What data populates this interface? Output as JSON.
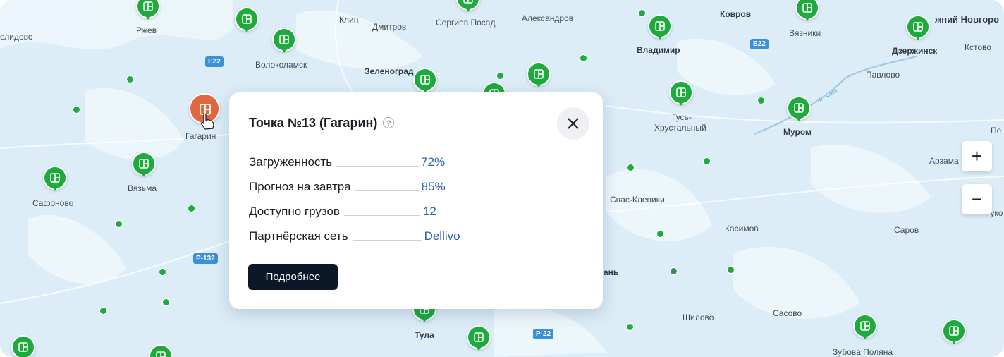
{
  "map": {
    "cities": [
      {
        "name": "Ржев"
      },
      {
        "name": "елидово"
      },
      {
        "name": "Клин"
      },
      {
        "name": "Дмитров"
      },
      {
        "name": "Сергиев Посад"
      },
      {
        "name": "Александров"
      },
      {
        "name": "Ковров"
      },
      {
        "name": "Вязники"
      },
      {
        "name": "жний Новгоро"
      },
      {
        "name": "Кстово"
      },
      {
        "name": "Волоколамск"
      },
      {
        "name": "Зеленоград"
      },
      {
        "name": "Владимир"
      },
      {
        "name": "Дзержинск"
      },
      {
        "name": "Павлово"
      },
      {
        "name": "Гагарин"
      },
      {
        "name": "Гусь-"
      },
      {
        "name": "Хрустальный"
      },
      {
        "name": "Муром"
      },
      {
        "name": "Пе"
      },
      {
        "name": "Вязьма"
      },
      {
        "name": "Арзама"
      },
      {
        "name": "Сафоново"
      },
      {
        "name": "Спас-Клепики"
      },
      {
        "name": "Касимов"
      },
      {
        "name": "Саров"
      },
      {
        "name": "ань"
      },
      {
        "name": "Шилово"
      },
      {
        "name": "Сасово"
      },
      {
        "name": "Тула"
      },
      {
        "name": "Зубова Поляна"
      },
      {
        "name": "гуко"
      }
    ],
    "roads": [
      "E22",
      "E22",
      "P-132",
      "P-22"
    ],
    "river": "р. Ока"
  },
  "popup": {
    "title": "Точка №13 (Гагарин)",
    "help_icon": "question-circle-icon",
    "help_glyph": "?",
    "close_icon": "close-icon",
    "rows": [
      {
        "label": "Загруженность",
        "value": "72%"
      },
      {
        "label": "Прогноз на завтра",
        "value": "85%"
      },
      {
        "label": "Доступно грузов",
        "value": "12"
      },
      {
        "label": "Партнёрская сеть",
        "value": "Dellivo"
      }
    ],
    "button": "Подробнее"
  },
  "zoom": {
    "in": "+",
    "out": "−"
  },
  "colors": {
    "marker": "#1faa3e",
    "selected_marker": "#e0683f",
    "water": "#dcedf7",
    "button": "#0c1828",
    "link": "#2a5fb0"
  }
}
